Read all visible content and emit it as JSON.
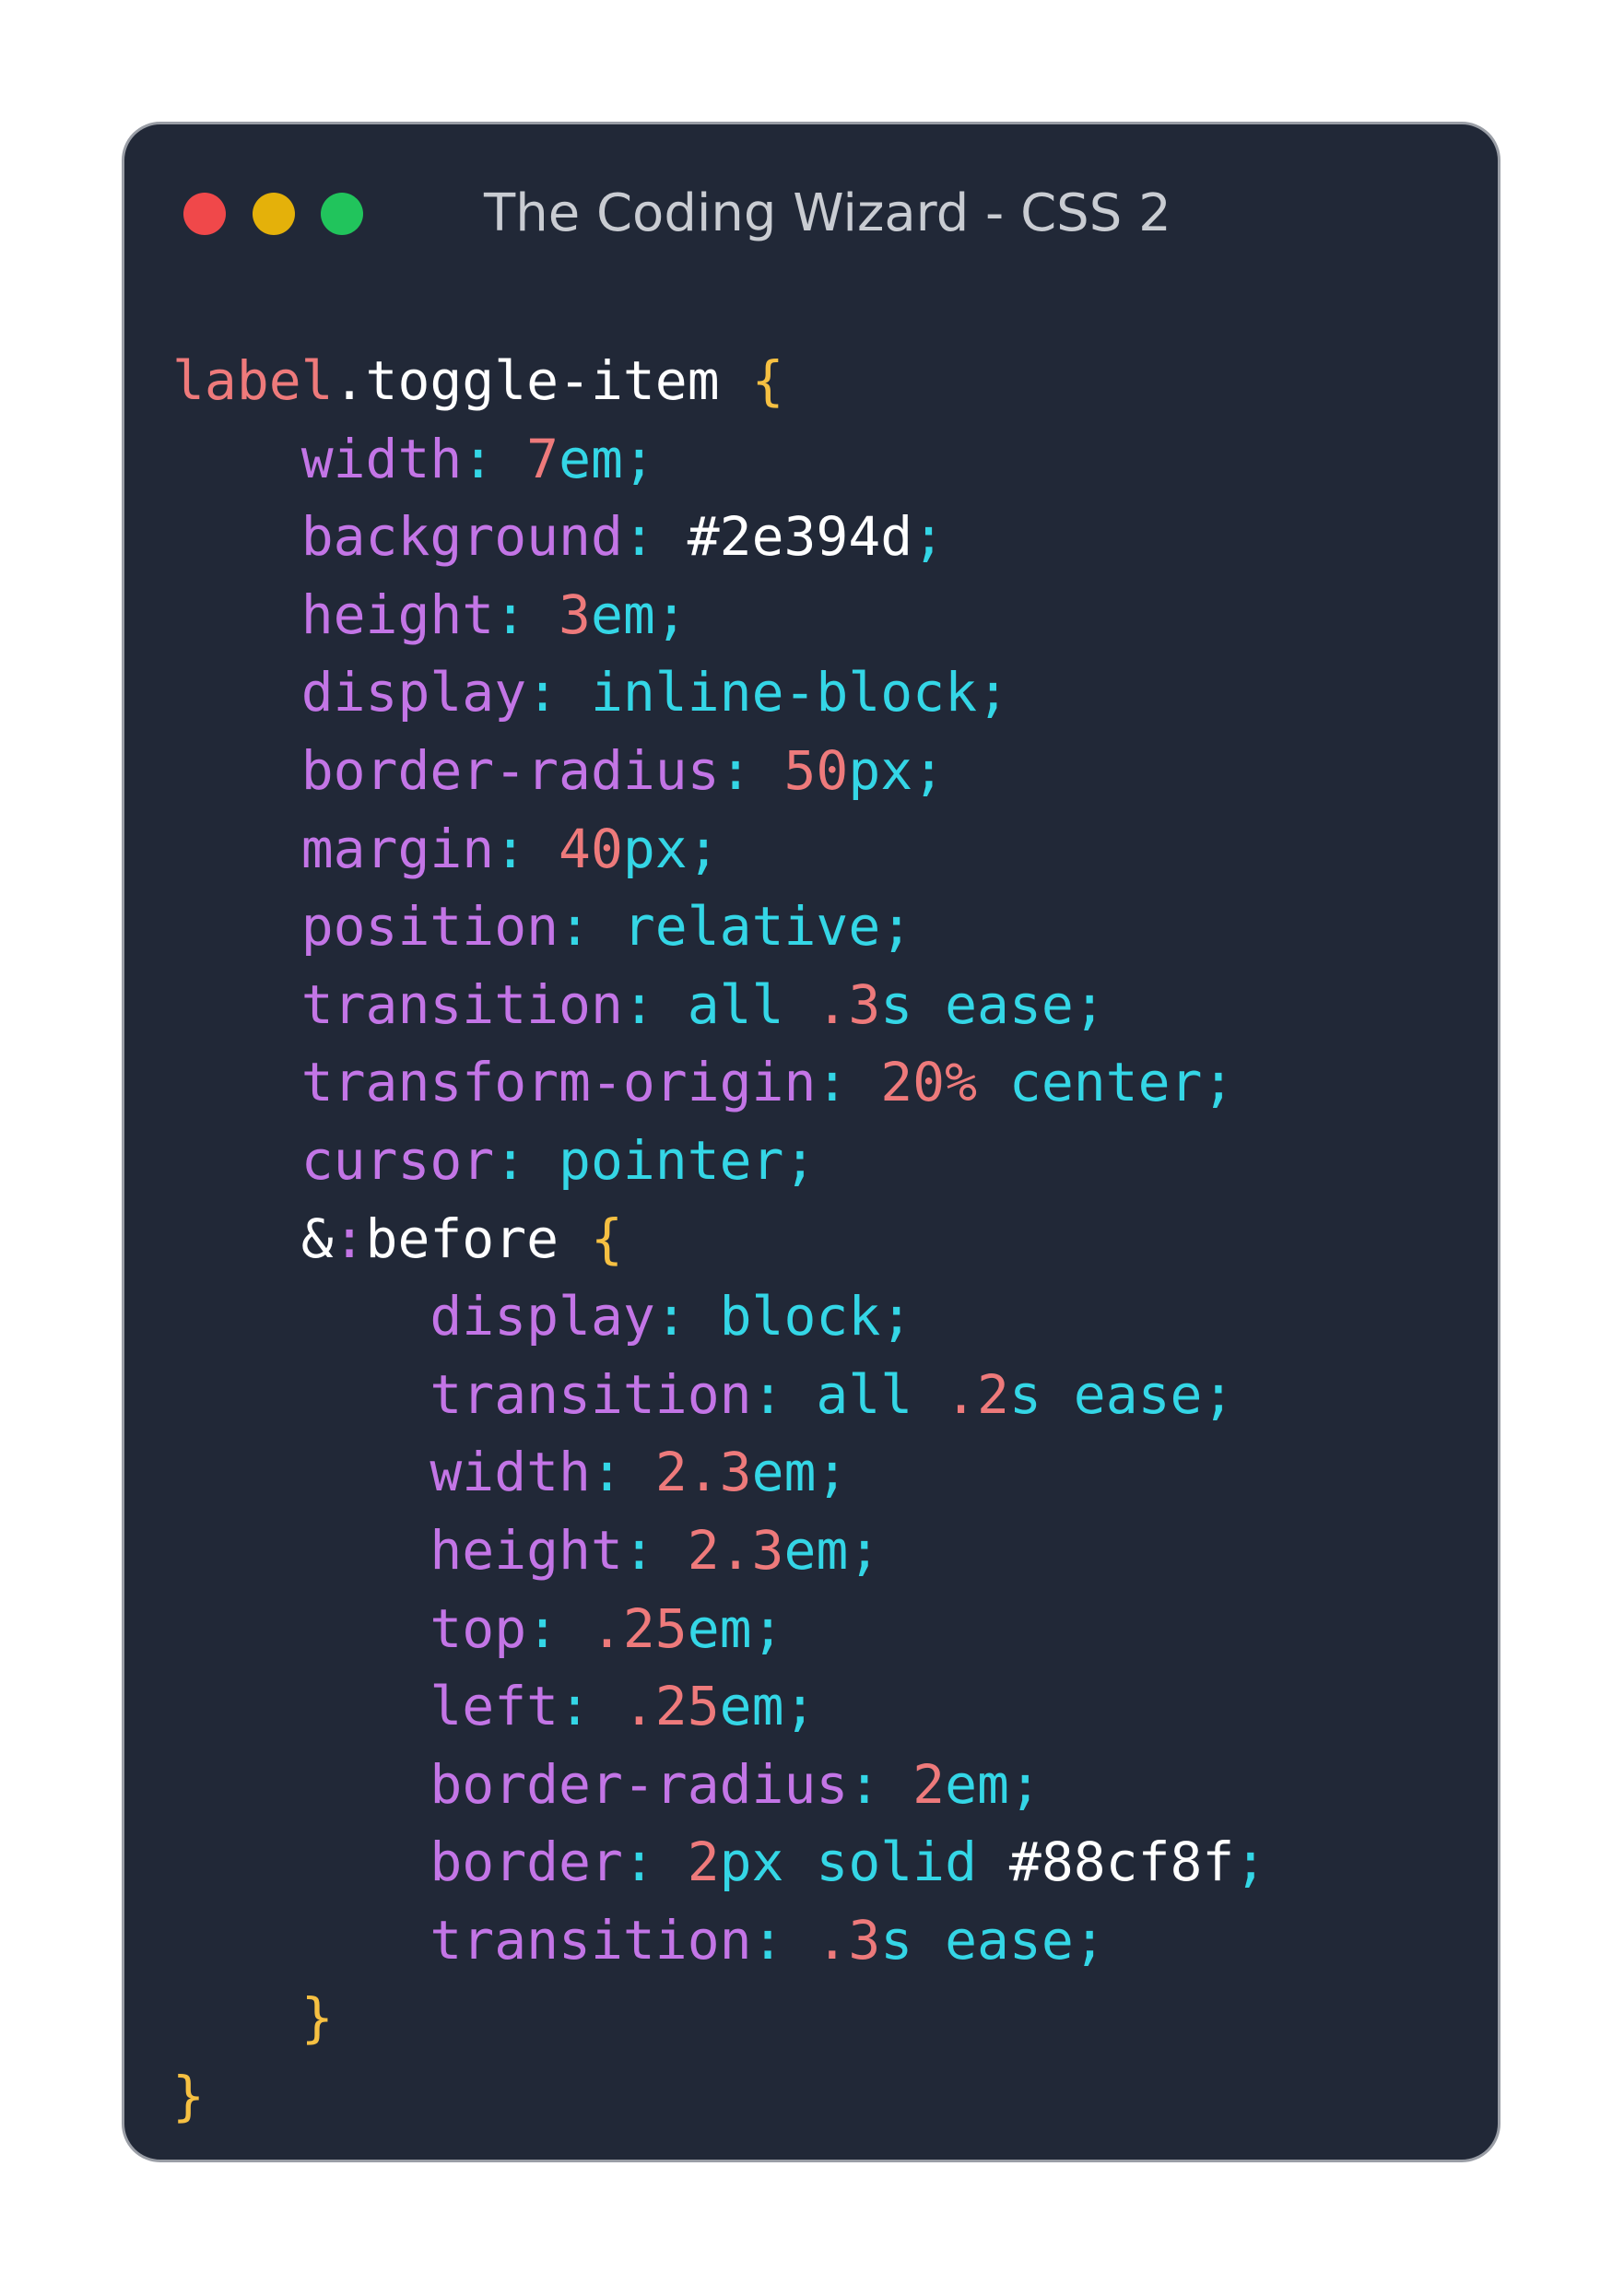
{
  "window": {
    "title": "The Coding Wizard - CSS 2"
  },
  "code_lines": [
    {
      "indent": 0,
      "tokens": [
        {
          "t": "label",
          "c": "sel"
        },
        {
          "t": ".toggle-item ",
          "c": "cls"
        },
        {
          "t": "{",
          "c": "brace"
        }
      ]
    },
    {
      "indent": 1,
      "tokens": [
        {
          "t": "width",
          "c": "prop"
        },
        {
          "t": ": ",
          "c": "colon"
        },
        {
          "t": "7",
          "c": "num"
        },
        {
          "t": "em",
          "c": "unit"
        },
        {
          "t": ";",
          "c": "semi"
        }
      ]
    },
    {
      "indent": 1,
      "tokens": [
        {
          "t": "background",
          "c": "prop"
        },
        {
          "t": ": ",
          "c": "colon"
        },
        {
          "t": "#2e394d",
          "c": "hex"
        },
        {
          "t": ";",
          "c": "semi"
        }
      ]
    },
    {
      "indent": 1,
      "tokens": [
        {
          "t": "height",
          "c": "prop"
        },
        {
          "t": ": ",
          "c": "colon"
        },
        {
          "t": "3",
          "c": "num"
        },
        {
          "t": "em",
          "c": "unit"
        },
        {
          "t": ";",
          "c": "semi"
        }
      ]
    },
    {
      "indent": 1,
      "tokens": [
        {
          "t": "display",
          "c": "prop"
        },
        {
          "t": ": ",
          "c": "colon"
        },
        {
          "t": "inline-block",
          "c": "kw"
        },
        {
          "t": ";",
          "c": "semi"
        }
      ]
    },
    {
      "indent": 1,
      "tokens": [
        {
          "t": "border-radius",
          "c": "prop"
        },
        {
          "t": ": ",
          "c": "colon"
        },
        {
          "t": "50",
          "c": "num"
        },
        {
          "t": "px",
          "c": "unit"
        },
        {
          "t": ";",
          "c": "semi"
        }
      ]
    },
    {
      "indent": 1,
      "tokens": [
        {
          "t": "margin",
          "c": "prop"
        },
        {
          "t": ": ",
          "c": "colon"
        },
        {
          "t": "40",
          "c": "num"
        },
        {
          "t": "px",
          "c": "unit"
        },
        {
          "t": ";",
          "c": "semi"
        }
      ]
    },
    {
      "indent": 1,
      "tokens": [
        {
          "t": "position",
          "c": "prop"
        },
        {
          "t": ": ",
          "c": "colon"
        },
        {
          "t": "relative",
          "c": "kw"
        },
        {
          "t": ";",
          "c": "semi"
        }
      ]
    },
    {
      "indent": 1,
      "tokens": [
        {
          "t": "transition",
          "c": "prop"
        },
        {
          "t": ": ",
          "c": "colon"
        },
        {
          "t": "all ",
          "c": "kw"
        },
        {
          "t": ".3",
          "c": "num"
        },
        {
          "t": "s ",
          "c": "unit"
        },
        {
          "t": "ease",
          "c": "kw"
        },
        {
          "t": ";",
          "c": "semi"
        }
      ]
    },
    {
      "indent": 1,
      "tokens": [
        {
          "t": "transform-origin",
          "c": "prop"
        },
        {
          "t": ": ",
          "c": "colon"
        },
        {
          "t": "20%",
          "c": "num"
        },
        {
          "t": " center",
          "c": "kw"
        },
        {
          "t": ";",
          "c": "semi"
        }
      ]
    },
    {
      "indent": 1,
      "tokens": [
        {
          "t": "cursor",
          "c": "prop"
        },
        {
          "t": ": ",
          "c": "colon"
        },
        {
          "t": "pointer",
          "c": "kw"
        },
        {
          "t": ";",
          "c": "semi"
        }
      ]
    },
    {
      "indent": 1,
      "tokens": [
        {
          "t": "&",
          "c": "amp"
        },
        {
          "t": ":",
          "c": "pseudo-colon"
        },
        {
          "t": "before ",
          "c": "pseudo"
        },
        {
          "t": "{",
          "c": "brace"
        }
      ]
    },
    {
      "indent": 2,
      "tokens": [
        {
          "t": "display",
          "c": "prop"
        },
        {
          "t": ": ",
          "c": "colon"
        },
        {
          "t": "block",
          "c": "kw"
        },
        {
          "t": ";",
          "c": "semi"
        }
      ]
    },
    {
      "indent": 2,
      "tokens": [
        {
          "t": "transition",
          "c": "prop"
        },
        {
          "t": ": ",
          "c": "colon"
        },
        {
          "t": "all ",
          "c": "kw"
        },
        {
          "t": ".2",
          "c": "num"
        },
        {
          "t": "s ",
          "c": "unit"
        },
        {
          "t": "ease",
          "c": "kw"
        },
        {
          "t": ";",
          "c": "semi"
        }
      ]
    },
    {
      "indent": 2,
      "tokens": [
        {
          "t": "width",
          "c": "prop"
        },
        {
          "t": ": ",
          "c": "colon"
        },
        {
          "t": "2.3",
          "c": "num"
        },
        {
          "t": "em",
          "c": "unit"
        },
        {
          "t": ";",
          "c": "semi"
        }
      ]
    },
    {
      "indent": 2,
      "tokens": [
        {
          "t": "height",
          "c": "prop"
        },
        {
          "t": ": ",
          "c": "colon"
        },
        {
          "t": "2.3",
          "c": "num"
        },
        {
          "t": "em",
          "c": "unit"
        },
        {
          "t": ";",
          "c": "semi"
        }
      ]
    },
    {
      "indent": 2,
      "tokens": [
        {
          "t": "top",
          "c": "prop"
        },
        {
          "t": ": ",
          "c": "colon"
        },
        {
          "t": ".25",
          "c": "num"
        },
        {
          "t": "em",
          "c": "unit"
        },
        {
          "t": ";",
          "c": "semi"
        }
      ]
    },
    {
      "indent": 2,
      "tokens": [
        {
          "t": "left",
          "c": "prop"
        },
        {
          "t": ": ",
          "c": "colon"
        },
        {
          "t": ".25",
          "c": "num"
        },
        {
          "t": "em",
          "c": "unit"
        },
        {
          "t": ";",
          "c": "semi"
        }
      ]
    },
    {
      "indent": 2,
      "tokens": [
        {
          "t": "border-radius",
          "c": "prop"
        },
        {
          "t": ": ",
          "c": "colon"
        },
        {
          "t": "2",
          "c": "num"
        },
        {
          "t": "em",
          "c": "unit"
        },
        {
          "t": ";",
          "c": "semi"
        }
      ]
    },
    {
      "indent": 2,
      "tokens": [
        {
          "t": "border",
          "c": "prop"
        },
        {
          "t": ": ",
          "c": "colon"
        },
        {
          "t": "2",
          "c": "num"
        },
        {
          "t": "px ",
          "c": "unit"
        },
        {
          "t": "solid ",
          "c": "kw"
        },
        {
          "t": "#88cf8f",
          "c": "hex"
        },
        {
          "t": ";",
          "c": "semi"
        }
      ]
    },
    {
      "indent": 2,
      "tokens": [
        {
          "t": "transition",
          "c": "prop"
        },
        {
          "t": ": ",
          "c": "colon"
        },
        {
          "t": ".3",
          "c": "num"
        },
        {
          "t": "s ",
          "c": "unit"
        },
        {
          "t": "ease",
          "c": "kw"
        },
        {
          "t": ";",
          "c": "semi"
        }
      ]
    },
    {
      "indent": 1,
      "tokens": [
        {
          "t": "}",
          "c": "brace"
        }
      ]
    },
    {
      "indent": 0,
      "tokens": [
        {
          "t": "}",
          "c": "brace"
        }
      ]
    }
  ]
}
